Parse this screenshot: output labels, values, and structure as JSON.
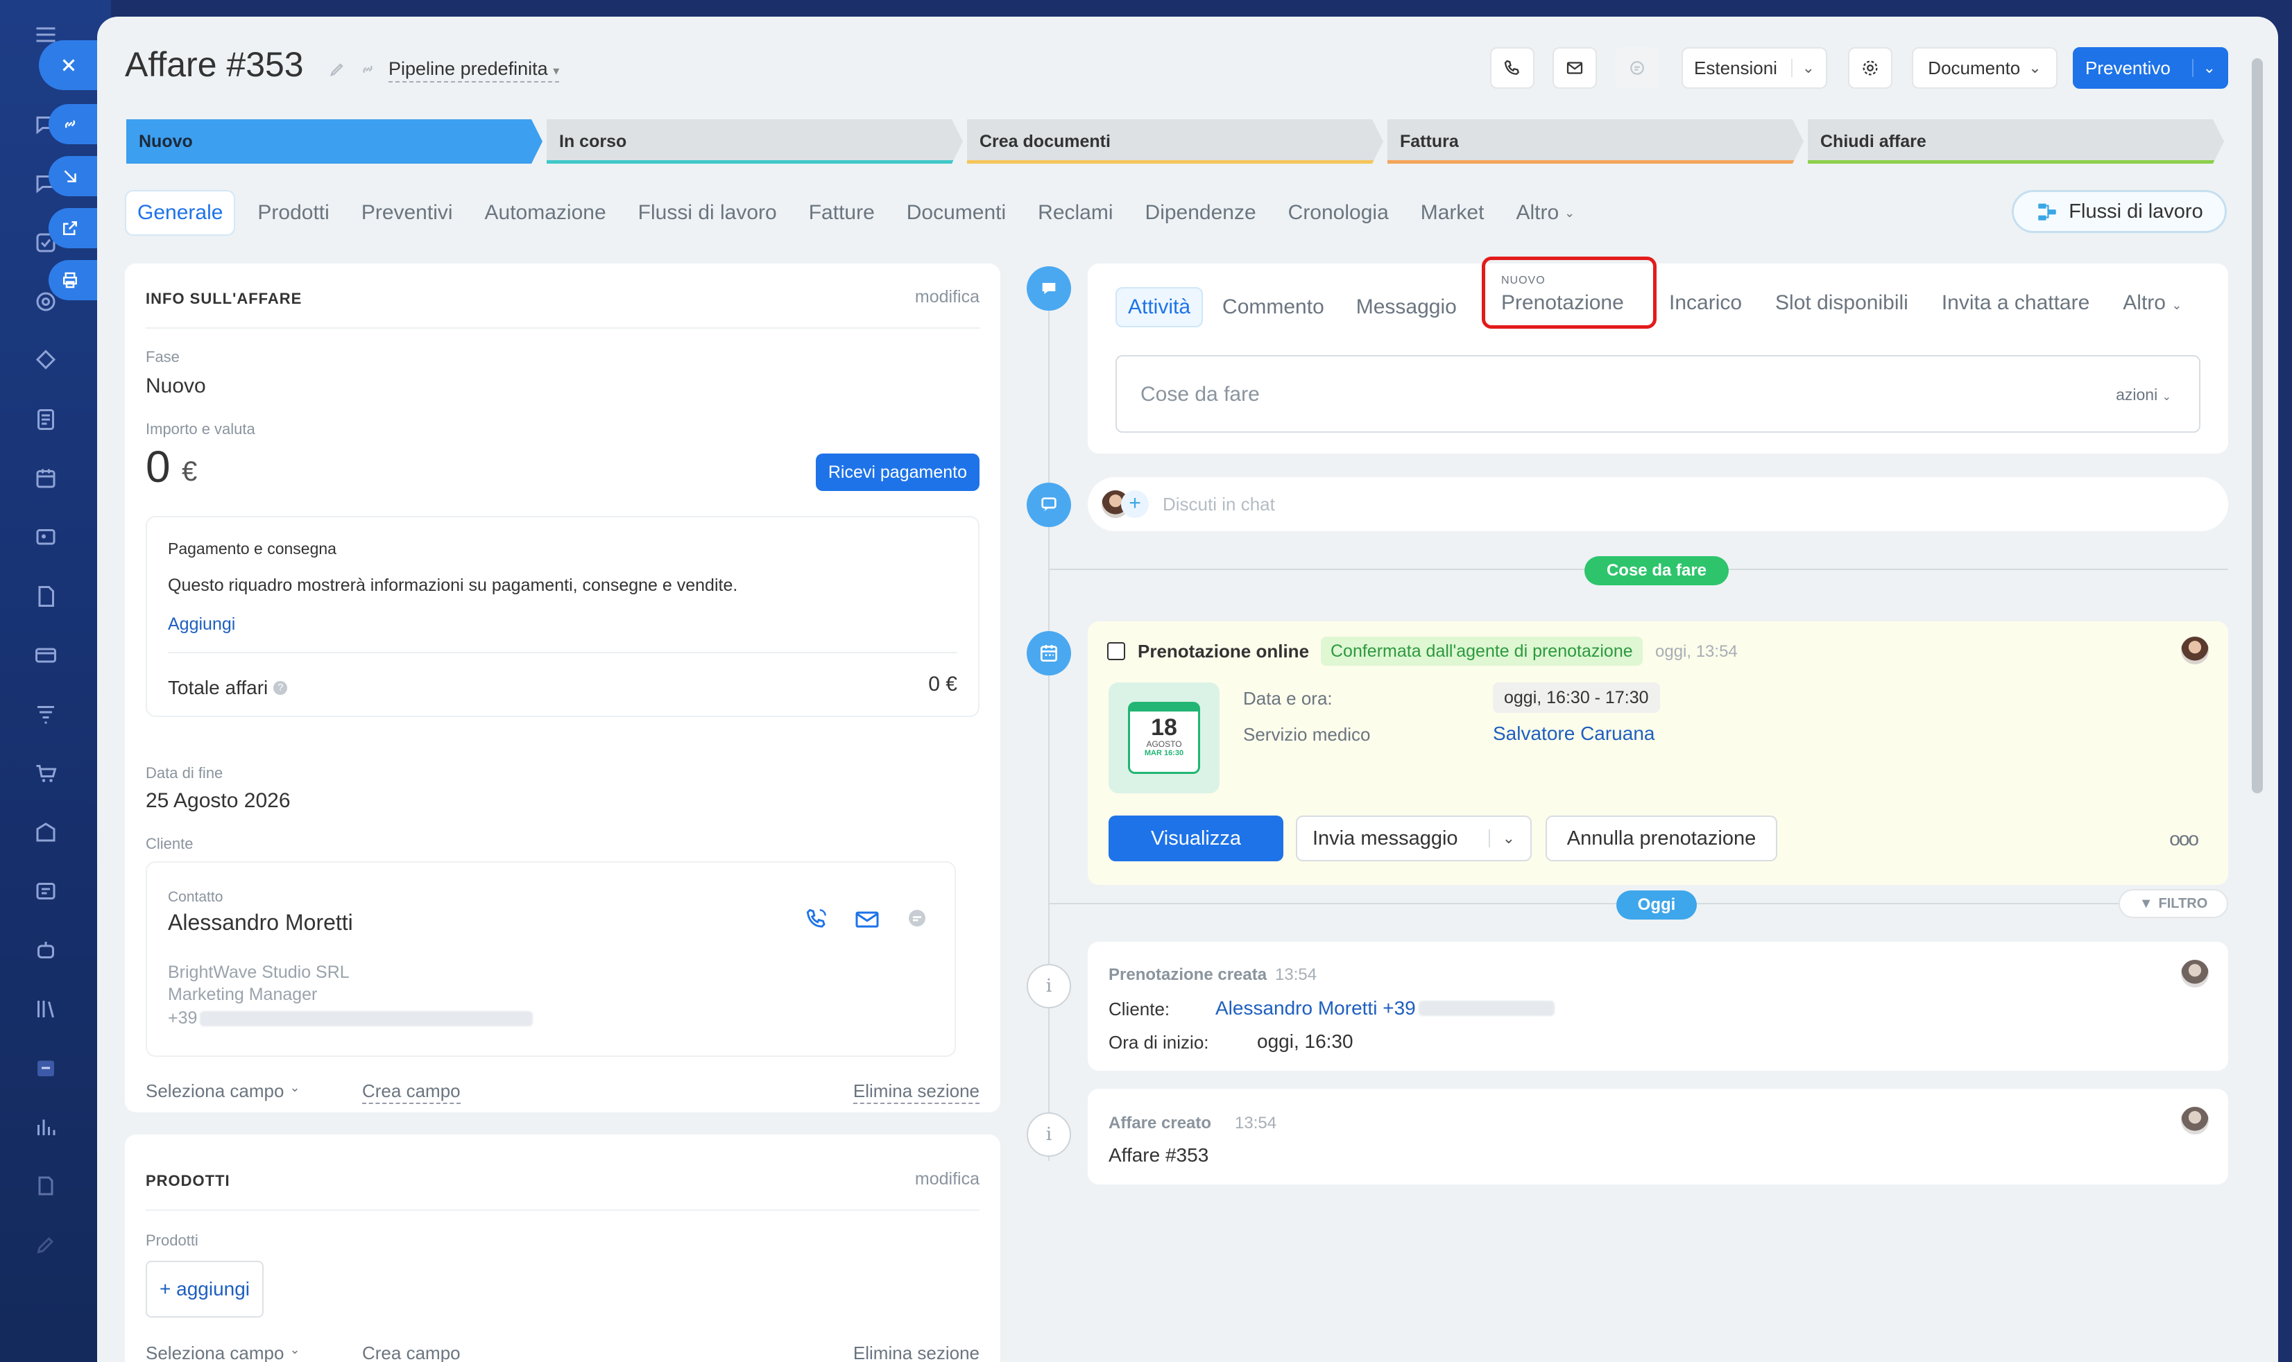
{
  "colors": {
    "accent": "#1e73e8",
    "sidebar": "#1b2f6b",
    "booking_bg": "#fdfdec",
    "todo_pill": "#2ec46c",
    "today_pill": "#3ea6ea"
  },
  "header": {
    "title": "Affare #353",
    "pipeline": "Pipeline predefinita",
    "extensions": "Estensioni",
    "document": "Documento",
    "quote": "Preventivo"
  },
  "stages": [
    {
      "label": "Nuovo"
    },
    {
      "label": "In corso"
    },
    {
      "label": "Crea documenti"
    },
    {
      "label": "Fattura"
    },
    {
      "label": "Chiudi affare"
    }
  ],
  "tabs": [
    "Generale",
    "Prodotti",
    "Preventivi",
    "Automazione",
    "Flussi di lavoro",
    "Fatture",
    "Documenti",
    "Reclami",
    "Dipendenze",
    "Cronologia",
    "Market",
    "Altro"
  ],
  "workflows_button": "Flussi di lavoro",
  "info": {
    "title": "INFO SULL'AFFARE",
    "edit": "modifica",
    "stage_label": "Fase",
    "stage_value": "Nuovo",
    "amount_label": "Importo e valuta",
    "amount": "0",
    "currency": "€",
    "receive_payment": "Ricevi pagamento",
    "payment_title": "Pagamento e consegna",
    "payment_text": "Questo riquadro mostrerà informazioni su pagamenti, consegne e vendite.",
    "payment_add": "Aggiungi",
    "total_label": "Totale affari",
    "total_value": "0 €",
    "end_date_label": "Data di fine",
    "end_date": "25 Agosto 2026",
    "client_label": "Cliente",
    "contact_label": "Contatto",
    "contact_name": "Alessandro Moretti",
    "company": "BrightWave Studio SRL",
    "role": "Marketing Manager",
    "phone_prefix": "+39",
    "select_field": "Seleziona campo",
    "create_field": "Crea campo",
    "delete_section": "Elimina sezione"
  },
  "products": {
    "title": "PRODOTTI",
    "edit": "modifica",
    "label": "Prodotti",
    "add": "+ aggiungi",
    "select_field": "Seleziona campo",
    "create_field": "Crea campo",
    "delete_section": "Elimina sezione"
  },
  "activity_tabs": {
    "items": [
      "Attività",
      "Commento",
      "Messaggio",
      "Prenotazione",
      "Incarico",
      "Slot disponibili",
      "Invita a chattare",
      "Altro"
    ],
    "new_badge": "NUOVO",
    "todo_placeholder": "Cose da fare",
    "actions": "azioni"
  },
  "chat": {
    "placeholder": "Discuti in chat"
  },
  "timeline": {
    "todo_pill": "Cose da fare",
    "booking": {
      "title": "Prenotazione online",
      "status": "Confermata dall'agente di prenotazione",
      "time": "oggi, 13:54",
      "cal_day": "18",
      "cal_month": "AGOSTO",
      "cal_weekday": "MAR 16:30",
      "date_label": "Data e ora:",
      "date_value": "oggi, 16:30 - 17:30",
      "service_label": "Servizio medico",
      "service_value": "Salvatore Caruana",
      "view": "Visualizza",
      "send_message": "Invia messaggio",
      "cancel": "Annulla prenotazione",
      "more": "ooo"
    },
    "today_pill": "Oggi",
    "filter": "FILTRO",
    "created_booking": {
      "title": "Prenotazione creata",
      "time": "13:54",
      "client_label": "Cliente:",
      "client_value": "Alessandro Moretti +39",
      "start_label": "Ora di inizio:",
      "start_value": "oggi, 16:30"
    },
    "created_deal": {
      "title": "Affare creato",
      "time": "13:54",
      "text": "Affare #353"
    }
  }
}
